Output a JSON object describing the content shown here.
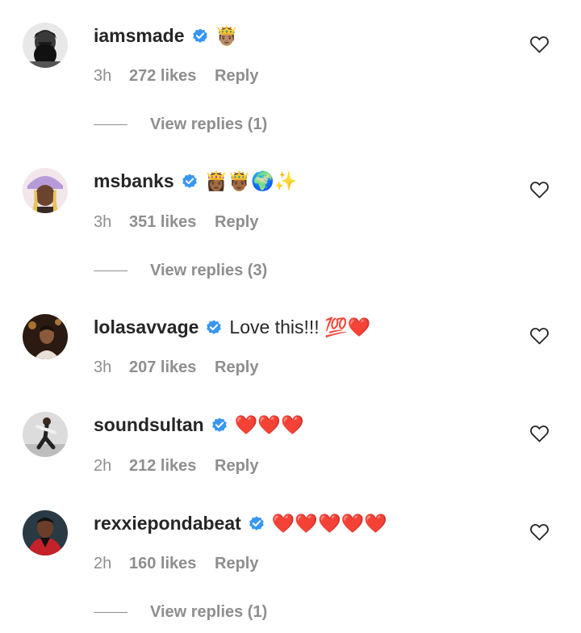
{
  "comments": [
    {
      "username": "iamsmade",
      "text": "🤴🏽",
      "time": "3h",
      "likes": "272 likes",
      "reply": "Reply",
      "view_replies": "View replies (1)",
      "avatar": "bearded-man-avatar"
    },
    {
      "username": "msbanks",
      "text": "👸🏾🤴🏾🌍✨",
      "time": "3h",
      "likes": "351 likes",
      "reply": "Reply",
      "view_replies": "View replies (3)",
      "avatar": "woman-lavender-hat-avatar"
    },
    {
      "username": "lolasavvage",
      "text": "Love this!!! 💯❤️",
      "time": "3h",
      "likes": "207 likes",
      "reply": "Reply",
      "avatar": "dark-portrait-avatar"
    },
    {
      "username": "soundsultan",
      "text": "❤️❤️❤️",
      "time": "2h",
      "likes": "212 likes",
      "reply": "Reply",
      "avatar": "dancing-man-avatar"
    },
    {
      "username": "rexxiepondabeat",
      "text": "❤️❤️❤️❤️❤️",
      "time": "2h",
      "likes": "160 likes",
      "reply": "Reply",
      "view_replies": "View replies (1)",
      "avatar": "man-red-jacket-avatar"
    }
  ],
  "colors": {
    "text": "#262626",
    "secondary": "#8e8e8e",
    "verified": "#3897f0"
  }
}
